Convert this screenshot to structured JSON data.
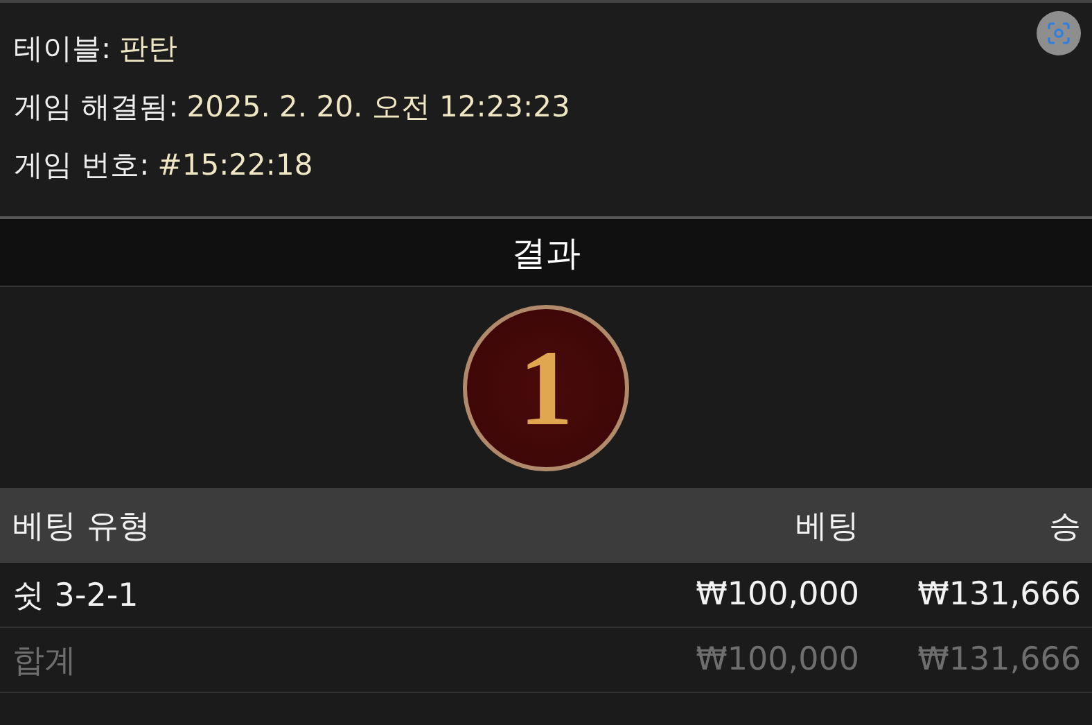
{
  "info": [
    {
      "label": "테이블:",
      "value": "판탄"
    },
    {
      "label": "게임 해결됨:",
      "value": "2025. 2. 20. 오전 12:23:23"
    },
    {
      "label": "게임 번호:",
      "value": "#15:22:18"
    }
  ],
  "result": {
    "title": "결과",
    "number": "1"
  },
  "table": {
    "columns": [
      "베팅 유형",
      "베팅",
      "승"
    ],
    "rows": [
      {
        "kind": "bet",
        "cells": [
          "쉿 3-2-1",
          "₩100,000",
          "₩131,666"
        ]
      },
      {
        "kind": "total",
        "cells": [
          "합계",
          "₩100,000",
          "₩131,666"
        ]
      }
    ]
  }
}
